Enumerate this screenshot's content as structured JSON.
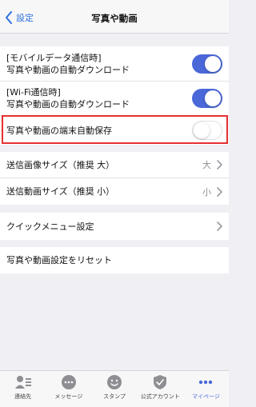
{
  "header": {
    "back_label": "設定",
    "title": "写真や動画"
  },
  "toggles": [
    {
      "line1": "[モバイルデータ通信時]",
      "line2": "写真や動画の自動ダウンロード",
      "state": "on"
    },
    {
      "line1": "[Wi-Fi通信時]",
      "line2": "写真や動画の自動ダウンロード",
      "state": "on"
    },
    {
      "line1": "写真や動画の端末自動保存",
      "line2": "",
      "state": "off"
    }
  ],
  "size_settings": [
    {
      "label": "送信画像サイズ（推奨 大）",
      "value": "大"
    },
    {
      "label": "送信動画サイズ（推奨 小）",
      "value": "小"
    }
  ],
  "quick_menu": {
    "label": "クイックメニュー設定"
  },
  "reset": {
    "label": "写真や動画設定をリセット"
  },
  "tabbar": {
    "items": [
      {
        "label": "連絡先",
        "icon": "contacts-icon"
      },
      {
        "label": "メッセージ",
        "icon": "message-icon"
      },
      {
        "label": "スタンプ",
        "icon": "stamp-icon"
      },
      {
        "label": "公式アカウント",
        "icon": "official-account-icon"
      },
      {
        "label": "マイページ",
        "icon": "mypage-icon",
        "active": true
      }
    ]
  },
  "colors": {
    "accent": "#4a68d8",
    "highlight": "#e53030",
    "back_link": "#2f6fe0"
  }
}
